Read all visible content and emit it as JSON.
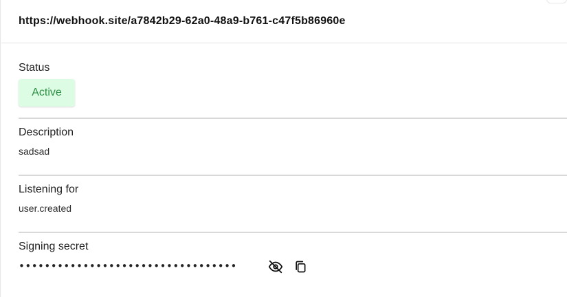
{
  "webhook": {
    "url": "https://webhook.site/a7842b29-62a0-48a9-b761-c47f5b86960e"
  },
  "status": {
    "label": "Status",
    "value": "Active",
    "color_bg": "#dcfce3",
    "color_text": "#2f8f45"
  },
  "description": {
    "label": "Description",
    "value": "sadsad"
  },
  "listening": {
    "label": "Listening for",
    "value": "user.created"
  },
  "signing_secret": {
    "label": "Signing secret",
    "masked_value": "••••••••••••••••••••••••••••••••••",
    "icons": [
      "eye-slash-icon",
      "copy-icon"
    ]
  }
}
